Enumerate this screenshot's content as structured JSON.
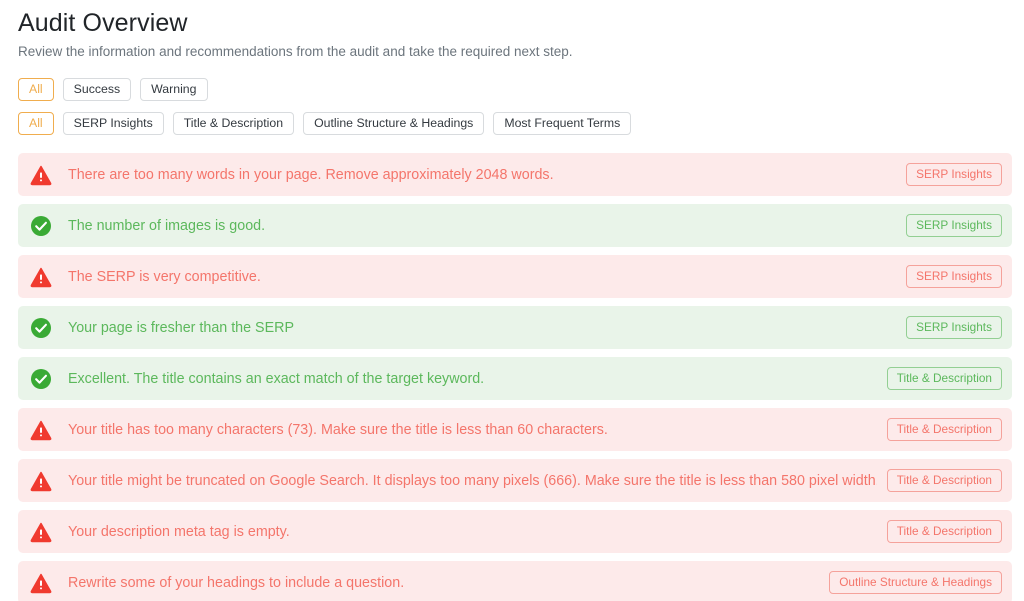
{
  "header": {
    "title": "Audit Overview",
    "subtitle": "Review the information and recommendations from the audit and take the required next step."
  },
  "colors": {
    "accent": "#f0ad4e",
    "warning_text": "#f4756b",
    "warning_bg": "#fdeaea",
    "warning_border": "#f5a29b",
    "success_text": "#5cb85c",
    "success_bg": "#e9f4e9",
    "success_border": "#93cf93",
    "title_text": "#212529",
    "subtitle_text": "#6c757d",
    "chip_text": "#343a40",
    "chip_border": "#d8dbde"
  },
  "status_filters": [
    {
      "label": "All",
      "active": true
    },
    {
      "label": "Success",
      "active": false
    },
    {
      "label": "Warning",
      "active": false
    }
  ],
  "category_filters": [
    {
      "label": "All",
      "active": true
    },
    {
      "label": "SERP Insights",
      "active": false
    },
    {
      "label": "Title & Description",
      "active": false
    },
    {
      "label": "Outline Structure & Headings",
      "active": false
    },
    {
      "label": "Most Frequent Terms",
      "active": false
    }
  ],
  "alerts": [
    {
      "type": "warning",
      "icon": "warning-triangle-icon",
      "message": "There are too many words in your page. Remove approximately 2048 words.",
      "badge": "SERP Insights"
    },
    {
      "type": "success",
      "icon": "check-circle-icon",
      "message": "The number of images is good.",
      "badge": "SERP Insights"
    },
    {
      "type": "warning",
      "icon": "warning-triangle-icon",
      "message": "The SERP is very competitive.",
      "badge": "SERP Insights"
    },
    {
      "type": "success",
      "icon": "check-circle-icon",
      "message": "Your page is fresher than the SERP",
      "badge": "SERP Insights"
    },
    {
      "type": "success",
      "icon": "check-circle-icon",
      "message": "Excellent. The title contains an exact match of the target keyword.",
      "badge": "Title & Description"
    },
    {
      "type": "warning",
      "icon": "warning-triangle-icon",
      "message": "Your title has too many characters (73). Make sure the title is less than 60 characters.",
      "badge": "Title & Description"
    },
    {
      "type": "warning",
      "icon": "warning-triangle-icon",
      "message": "Your title might be truncated on Google Search. It displays too many pixels (666). Make sure the title is less than 580 pixel width.",
      "badge": "Title & Description"
    },
    {
      "type": "warning",
      "icon": "warning-triangle-icon",
      "message": "Your description meta tag is empty.",
      "badge": "Title & Description"
    },
    {
      "type": "warning",
      "icon": "warning-triangle-icon",
      "message": "Rewrite some of your headings to include a question.",
      "badge": "Outline Structure & Headings"
    }
  ]
}
